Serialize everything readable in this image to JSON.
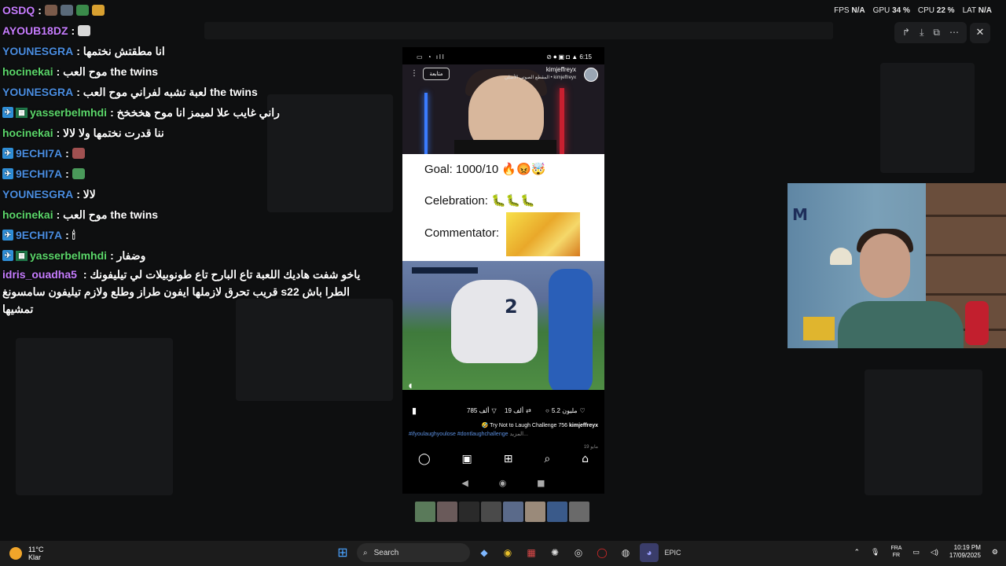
{
  "stats": [
    {
      "label": "FPS",
      "value": "N/A"
    },
    {
      "label": "GPU",
      "value": "34 %"
    },
    {
      "label": "CPU",
      "value": "22 %"
    },
    {
      "label": "LAT",
      "value": "N/A"
    }
  ],
  "chat": [
    {
      "user": "OSDQ",
      "color": "#c77dff",
      "text": ":"
    },
    {
      "user": "AYOUB18DZ",
      "color": "#c77dff",
      "text": ":"
    },
    {
      "user": "YOUNESGRA",
      "color": "#4a8de0",
      "text": ": انا مطقتش نختمها"
    },
    {
      "user": "hocinekai",
      "color": "#5bd66a",
      "text": ": موح العب the twins"
    },
    {
      "user": "YOUNESGRA",
      "color": "#4a8de0",
      "text": ": لعبة تشبه لفراني موح العب the twins"
    },
    {
      "user": "yasserbelmhdi",
      "color": "#5bd66a",
      "text": ": راني غايب علا لميمز انا موح هخخخخ"
    },
    {
      "user": "hocinekai",
      "color": "#5bd66a",
      "text": ": ننا قدرت نختمها ولا لالا"
    },
    {
      "user": "9ECHI7A",
      "color": "#4a8de0",
      "text": ":"
    },
    {
      "user": "9ECHI7A",
      "color": "#4a8de0",
      "text": ":"
    },
    {
      "user": "YOUNESGRA",
      "color": "#4a8de0",
      "text": ": لالا"
    },
    {
      "user": "hocinekai",
      "color": "#5bd66a",
      "text": ": موح العب the twins"
    },
    {
      "user": "9ECHI7A",
      "color": "#4a8de0",
      "text": ": 🕯"
    },
    {
      "user": "yasserbelmhdi",
      "color": "#5bd66a",
      "text": ": وضفار"
    },
    {
      "user": "idris_ouadha5",
      "color": "#c77dff",
      "text": ": ياخو شفت هاديك اللعبة تاع البارح تاع طونوبيلات لي تيليفونك قريب تحرق لازملها ايفون طراز وطلع ولازم تيليفون سامسونغ s22 الطرا باش تمشيها"
    }
  ],
  "phone": {
    "status_time": "6:15",
    "follow_label": "متابعة",
    "account": "kimjeffreyx",
    "account_sub": "المقطع الصوتي الأصلي • kimjeffreyx",
    "meme_goal": "Goal: 1000/10 🔥😡🤯",
    "meme_celebration": "Celebration: 🐛🐛🐛",
    "meme_commentator": "Commentator:",
    "likes": "5.2 مليون",
    "comments": "19 ألف",
    "shares": "785 ألف",
    "caption": "🤣 Try Not to Laugh Challenge 756",
    "caption_user": "kimjeffreyx",
    "tags": "#ifyoulaughyoulose #dontlaughchallenge",
    "more": "المزيد...",
    "date": "19 مايو"
  },
  "taskbar": {
    "temp": "11°C",
    "weather": "Klar",
    "search": "Search",
    "lang1": "FRA",
    "lang2": "FR",
    "time": "10:19 PM",
    "date": "17/09/2025"
  },
  "colors": {
    "accent": "#c77dff",
    "chat_blue": "#4a8de0",
    "chat_green": "#5bd66a"
  }
}
